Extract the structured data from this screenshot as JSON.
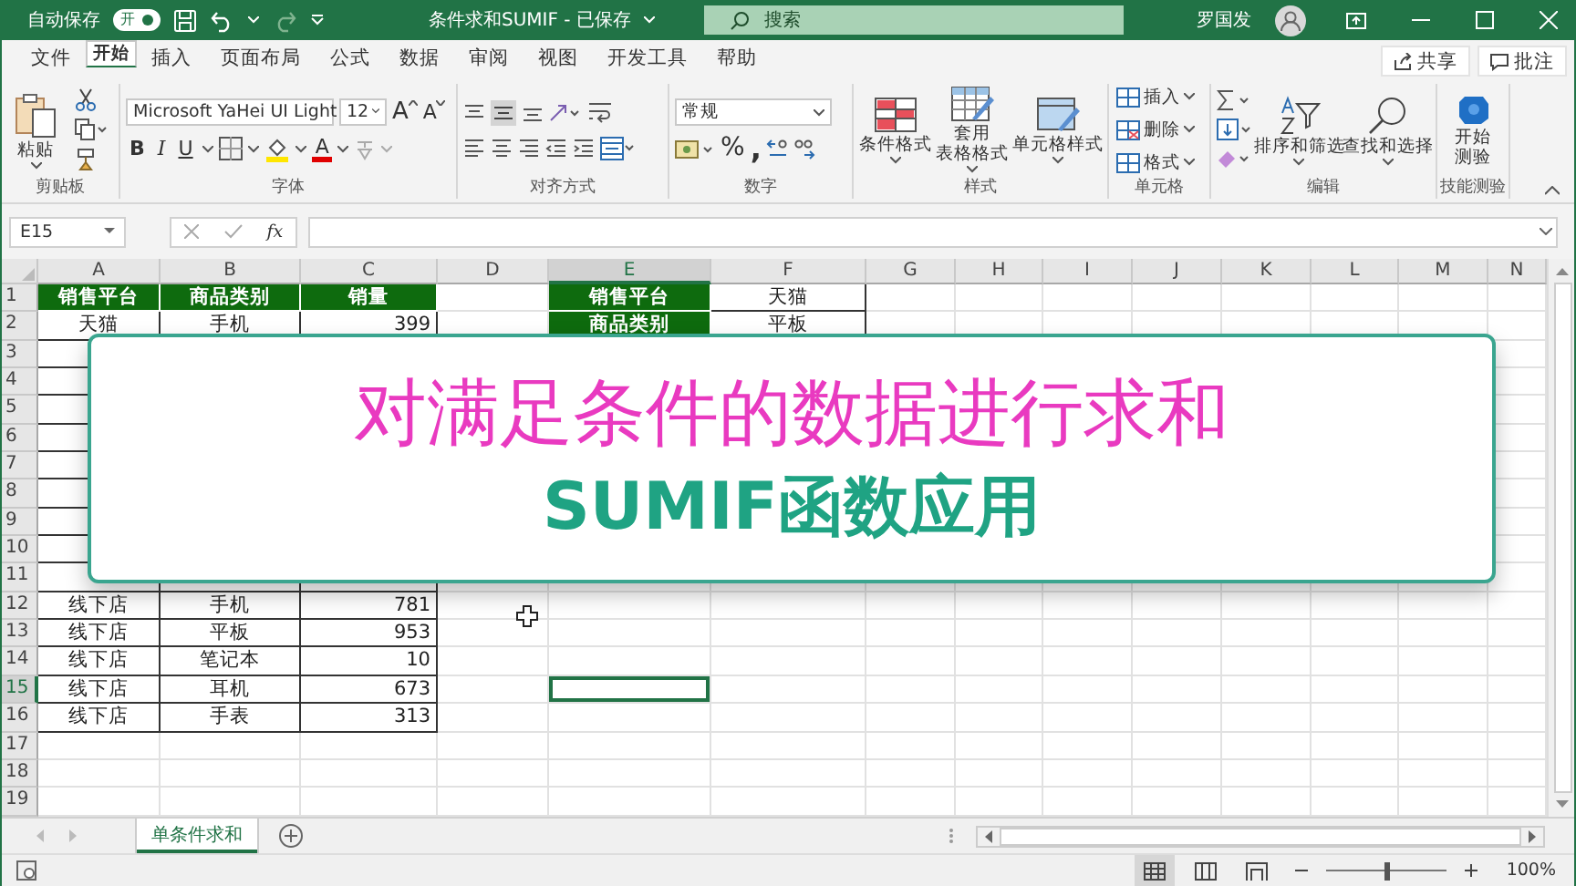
{
  "title_bar": {
    "autosave_label": "自动保存",
    "autosave": {
      "label": "开",
      "on": true
    },
    "document_title": "条件求和SUMIF - 已保存",
    "search": {
      "placeholder": "搜索"
    },
    "user_name": "罗国发"
  },
  "menu_tabs": [
    {
      "label": "文件",
      "selected": false
    },
    {
      "label": "开始",
      "selected": true
    },
    {
      "label": "插入",
      "selected": false
    },
    {
      "label": "页面布局",
      "selected": false
    },
    {
      "label": "公式",
      "selected": false
    },
    {
      "label": "数据",
      "selected": false
    },
    {
      "label": "审阅",
      "selected": false
    },
    {
      "label": "视图",
      "selected": false
    },
    {
      "label": "开发工具",
      "selected": false
    },
    {
      "label": "帮助",
      "selected": false
    }
  ],
  "menu_actions": [
    "共享",
    "批注"
  ],
  "ribbon": {
    "clipboard": {
      "paste": "粘贴",
      "label": "剪贴板"
    },
    "font": {
      "name": "Microsoft YaHei UI Light",
      "size": "12",
      "grow": "A",
      "shrink": "A",
      "bold": "B",
      "italic": "I",
      "underline": "U",
      "font_color_letter": "A",
      "label": "字体"
    },
    "alignment": {
      "label": "对齐方式"
    },
    "number": {
      "format": "常规",
      "percent": "%",
      "comma": ",",
      "label": "数字"
    },
    "styles": {
      "buttons": [
        [
          "条件格式"
        ],
        [
          "套用",
          "表格格式"
        ],
        [
          "单元格样式"
        ]
      ],
      "label": "样式"
    },
    "cells": {
      "buttons": [
        "插入",
        "删除",
        "格式"
      ],
      "label": "单元格"
    },
    "editing": {
      "buttons": [
        "排序和筛选",
        "查找和选择"
      ],
      "label": "编辑"
    },
    "quiz": {
      "button": [
        "开始",
        "测验"
      ],
      "label": "技能测验"
    }
  },
  "formula_bar": {
    "name_box": "E15",
    "function_button": "fx"
  },
  "sheet": {
    "columns": [
      {
        "label": "A",
        "selected": false
      },
      {
        "label": "B",
        "selected": false
      },
      {
        "label": "C",
        "selected": false
      },
      {
        "label": "D",
        "selected": false
      },
      {
        "label": "E",
        "selected": true
      },
      {
        "label": "F",
        "selected": false
      },
      {
        "label": "G",
        "selected": false
      },
      {
        "label": "H",
        "selected": false
      },
      {
        "label": "I",
        "selected": false
      },
      {
        "label": "J",
        "selected": false
      },
      {
        "label": "K",
        "selected": false
      },
      {
        "label": "L",
        "selected": false
      },
      {
        "label": "M",
        "selected": false
      },
      {
        "label": "N",
        "selected": false
      }
    ],
    "rows": [
      {
        "label": "1",
        "selected": false,
        "cells": [
          {
            "text": "销售平台",
            "kind": "header"
          },
          {
            "text": "商品类别",
            "kind": "header"
          },
          {
            "text": "销量",
            "kind": "header"
          },
          null,
          {
            "text": "销售平台",
            "kind": "header"
          },
          {
            "text": "天猫",
            "kind": "text"
          }
        ]
      },
      {
        "label": "2",
        "selected": false,
        "cells": [
          {
            "text": "天猫",
            "kind": "text"
          },
          {
            "text": "手机",
            "kind": "text"
          },
          {
            "text": "399",
            "kind": "number"
          },
          null,
          {
            "text": "商品类别",
            "kind": "header"
          },
          {
            "text": "平板",
            "kind": "text"
          }
        ]
      },
      {
        "label": "3",
        "selected": false,
        "cells": [
          {
            "kind": "boxed"
          },
          {
            "kind": "boxed"
          },
          {
            "kind": "boxed"
          }
        ]
      },
      {
        "label": "4",
        "selected": false,
        "cells": [
          {
            "kind": "boxed"
          },
          {
            "kind": "boxed"
          },
          {
            "kind": "boxed"
          }
        ]
      },
      {
        "label": "5",
        "selected": false,
        "cells": [
          {
            "kind": "boxed"
          },
          {
            "kind": "boxed"
          },
          {
            "kind": "boxed"
          }
        ]
      },
      {
        "label": "6",
        "selected": false,
        "cells": [
          {
            "kind": "boxed"
          },
          {
            "kind": "boxed"
          },
          {
            "kind": "boxed"
          }
        ]
      },
      {
        "label": "7",
        "selected": false,
        "cells": [
          {
            "kind": "boxed"
          },
          {
            "kind": "boxed"
          },
          {
            "kind": "boxed"
          }
        ]
      },
      {
        "label": "8",
        "selected": false,
        "cells": [
          {
            "kind": "boxed"
          },
          {
            "kind": "boxed"
          },
          {
            "kind": "boxed"
          }
        ]
      },
      {
        "label": "9",
        "selected": false,
        "cells": [
          {
            "kind": "boxed"
          },
          {
            "kind": "boxed"
          },
          {
            "kind": "boxed"
          }
        ]
      },
      {
        "label": "10",
        "selected": false,
        "cells": [
          {
            "kind": "boxed"
          },
          {
            "kind": "boxed"
          },
          {
            "kind": "boxed"
          }
        ]
      },
      {
        "label": "11",
        "selected": false,
        "cells": [
          {
            "kind": "boxed"
          },
          {
            "kind": "boxed"
          },
          {
            "kind": "boxed"
          }
        ]
      },
      {
        "label": "12",
        "selected": false,
        "cells": [
          {
            "text": "线下店",
            "kind": "text"
          },
          {
            "text": "手机",
            "kind": "text"
          },
          {
            "text": "781",
            "kind": "number"
          }
        ]
      },
      {
        "label": "13",
        "selected": false,
        "cells": [
          {
            "text": "线下店",
            "kind": "text"
          },
          {
            "text": "平板",
            "kind": "text"
          },
          {
            "text": "953",
            "kind": "number"
          }
        ]
      },
      {
        "label": "14",
        "selected": false,
        "cells": [
          {
            "text": "线下店",
            "kind": "text"
          },
          {
            "text": "笔记本",
            "kind": "text"
          },
          {
            "text": "10",
            "kind": "number"
          }
        ]
      },
      {
        "label": "15",
        "selected": true,
        "cells": [
          {
            "text": "线下店",
            "kind": "text"
          },
          {
            "text": "耳机",
            "kind": "text"
          },
          {
            "text": "673",
            "kind": "number"
          },
          null,
          {
            "kind": "active"
          }
        ]
      },
      {
        "label": "16",
        "selected": false,
        "cells": [
          {
            "text": "线下店",
            "kind": "text"
          },
          {
            "text": "手表",
            "kind": "text"
          },
          {
            "text": "313",
            "kind": "number"
          }
        ]
      },
      {
        "label": "17",
        "selected": false,
        "cells": []
      },
      {
        "label": "18",
        "selected": false,
        "cells": []
      },
      {
        "label": "19",
        "selected": false,
        "cells": []
      }
    ]
  },
  "overlay": {
    "title": "对满足条件的数据进行求和",
    "subtitle": "SUMIF函数应用"
  },
  "sheet_tabs": [
    {
      "label": "单条件求和",
      "selected": true
    }
  ],
  "status_bar": {
    "views": [
      {
        "selected": true
      },
      {
        "selected": false
      },
      {
        "selected": false
      }
    ],
    "zoom": {
      "level": 0.5,
      "reading": "100%"
    }
  }
}
